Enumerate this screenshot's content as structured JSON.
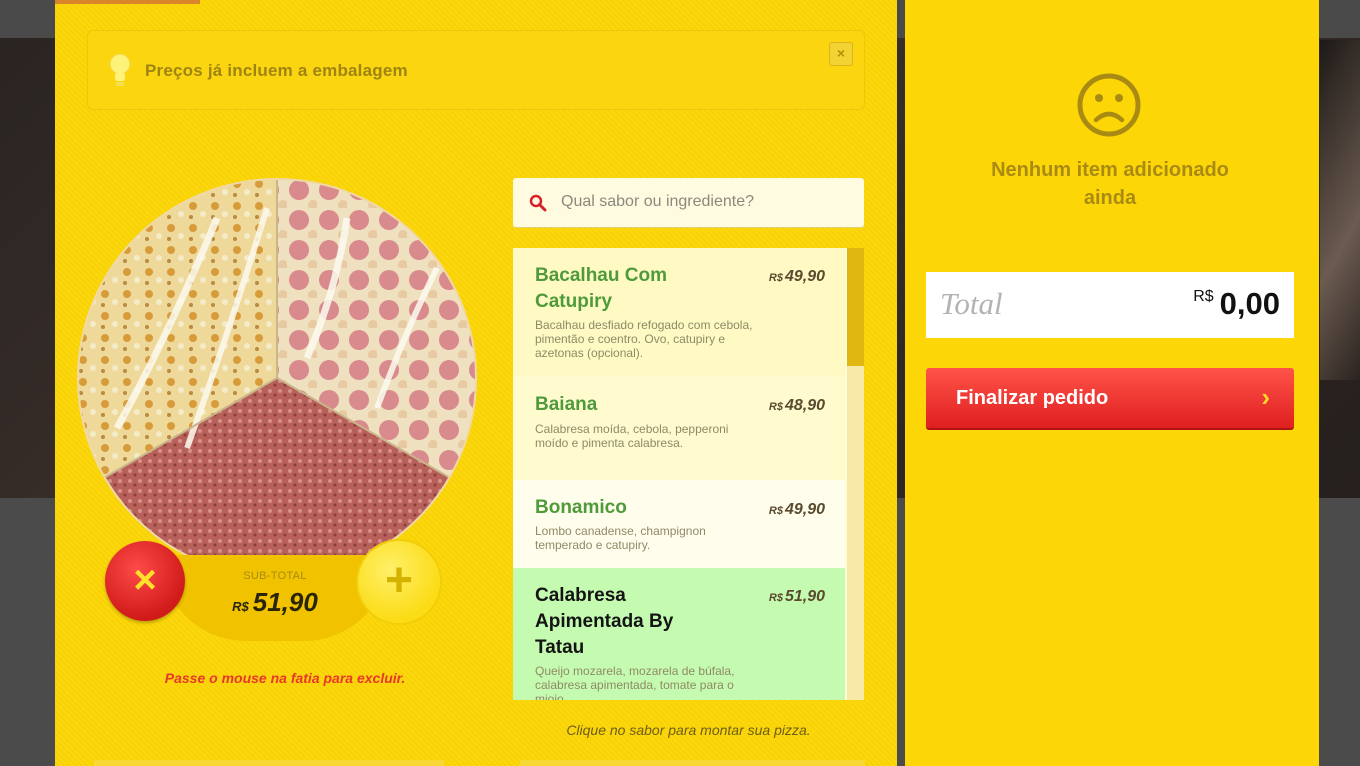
{
  "notice": {
    "text": "Preços já incluem a embalagem",
    "close_label": "×"
  },
  "pizza": {
    "remove_label": "×",
    "add_label": "+",
    "subtotal_label": "SUB-TOTAL",
    "subtotal_currency": "R$",
    "subtotal_value": "51,90",
    "hint": "Passe o mouse na fatia para excluir."
  },
  "search": {
    "placeholder": "Qual sabor ou ingrediente?"
  },
  "flavors": [
    {
      "name": "Bacalhau Com Catupiry",
      "currency": "R$",
      "price": "49,90",
      "description": "Bacalhau desfiado refogado com cebola, pimentão e coentro. Ovo, catupiry e azetonas (opcional)."
    },
    {
      "name": "Baiana",
      "currency": "R$",
      "price": "48,90",
      "description": "Calabresa moída, cebola, pepperoni moído e pimenta calabresa."
    },
    {
      "name": "Bonamico",
      "currency": "R$",
      "price": "49,90",
      "description": "Lombo canadense, champignon temperado e catupiry."
    },
    {
      "name": "Calabresa Apimentada By Tatau",
      "currency": "R$",
      "price": "51,90",
      "description": "Queijo mozarela, mozarela de búfala, calabresa apimentada, tomate para o miojo"
    }
  ],
  "list_hint": "Clique no sabor para montar sua pizza.",
  "cart": {
    "empty_message": "Nenhum item adicionado ainda",
    "total_label": "Total",
    "total_currency": "R$",
    "total_value": "0,00",
    "finish_label": "Finalizar pedido",
    "finish_arrow": "›"
  },
  "colors": {
    "panel": "#fcd606",
    "accent_red": "#e8382b",
    "flavor_selected": "#c5fbb0",
    "flavor_name_green": "#4f9a3a"
  }
}
